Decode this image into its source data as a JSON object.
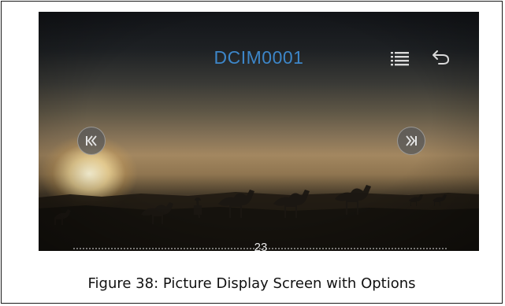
{
  "screen": {
    "title": "DCIM0001",
    "list_button": {
      "icon": "list-icon",
      "color": "#d9d9d9"
    },
    "back_button": {
      "icon": "back-arrow-icon",
      "color": "#d9d9d9"
    },
    "prev_button": {
      "icon": "skip-previous-icon"
    },
    "next_button": {
      "icon": "skip-next-icon"
    },
    "progress": {
      "value": 23
    }
  },
  "caption": "Figure 38: Picture Display Screen with Options",
  "colors": {
    "title": "#3d86c8",
    "frame_border": "#1a1a1a"
  }
}
